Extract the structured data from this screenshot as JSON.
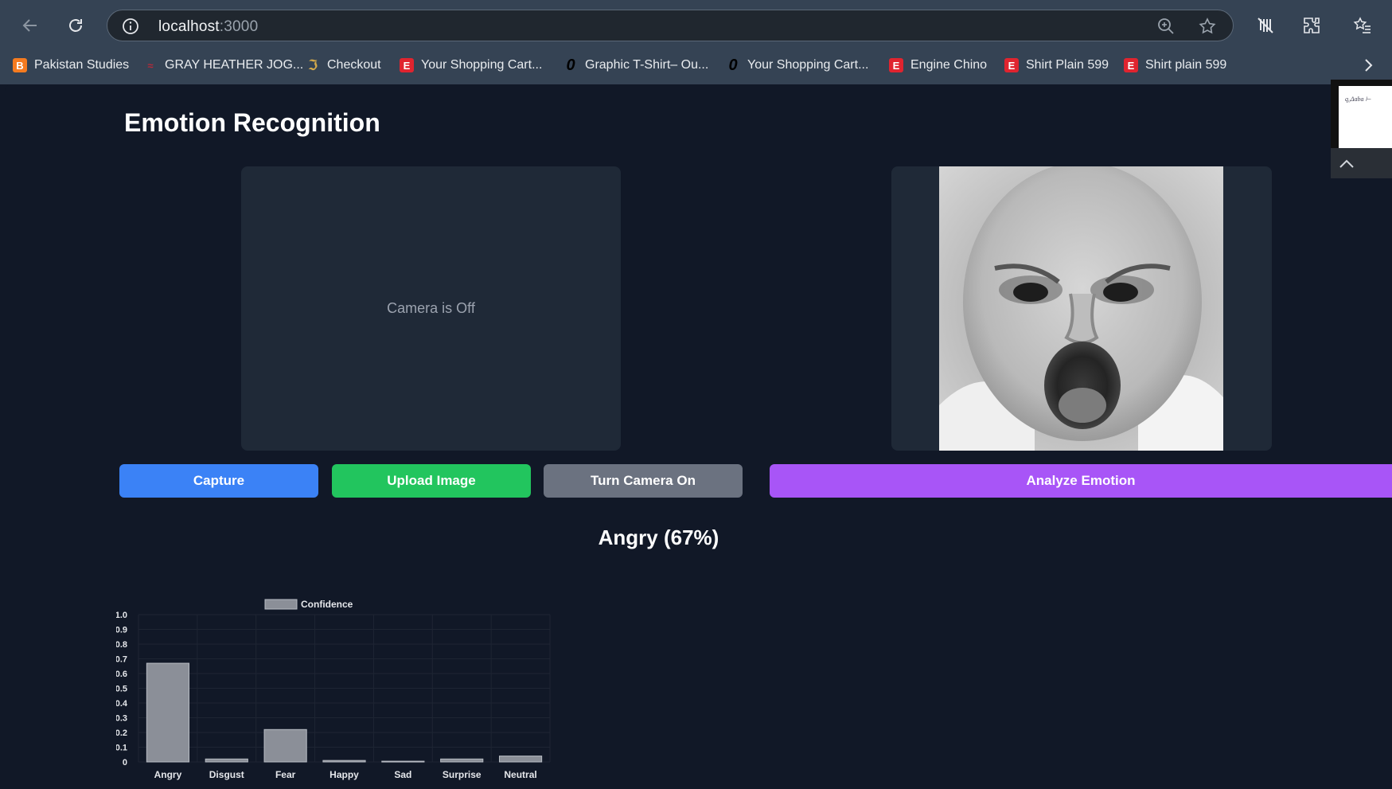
{
  "browser": {
    "url_host": "localhost",
    "url_port": ":3000",
    "bookmarks": [
      {
        "label": "Pakistan Studies",
        "icon": "blogger-icon"
      },
      {
        "label": "GRAY HEATHER JOG...",
        "icon": "brand-swoosh-icon"
      },
      {
        "label": "Checkout",
        "icon": "j-brand-icon"
      },
      {
        "label": "Your Shopping Cart...",
        "icon": "e-store-icon"
      },
      {
        "label": "Graphic T-Shirt– Ou...",
        "icon": "o-brand-icon"
      },
      {
        "label": "Your Shopping Cart...",
        "icon": "o-brand-icon"
      },
      {
        "label": "Engine Chino",
        "icon": "e-store-icon"
      },
      {
        "label": "Shirt Plain 599",
        "icon": "e-store-icon"
      },
      {
        "label": "Shirt plain 599",
        "icon": "e-store-icon"
      }
    ]
  },
  "app": {
    "title": "Emotion Recognition",
    "camera_status": "Camera is Off",
    "buttons": {
      "capture": "Capture",
      "upload": "Upload Image",
      "camera": "Turn Camera On",
      "analyze": "Analyze Emotion"
    },
    "result": "Angry (67%)"
  },
  "colors": {
    "background": "#111827",
    "panel": "#1f2937",
    "capture": "#3b82f6",
    "upload": "#22c55e",
    "camera": "#6b7280",
    "analyze": "#a855f7",
    "bar_fill": "#8b8f98"
  },
  "chart_data": {
    "type": "bar",
    "categories": [
      "Angry",
      "Disgust",
      "Fear",
      "Happy",
      "Sad",
      "Surprise",
      "Neutral"
    ],
    "series": [
      {
        "name": "Confidence",
        "values": [
          0.67,
          0.02,
          0.22,
          0.01,
          0.005,
          0.02,
          0.04
        ]
      }
    ],
    "ylim": [
      0,
      1.0
    ],
    "yticks": [
      "0",
      "0.1",
      "0.2",
      "0.3",
      "0.4",
      "0.5",
      "0.6",
      "0.7",
      "0.8",
      "0.9",
      "1.0"
    ],
    "legend": "top",
    "grid": true
  }
}
